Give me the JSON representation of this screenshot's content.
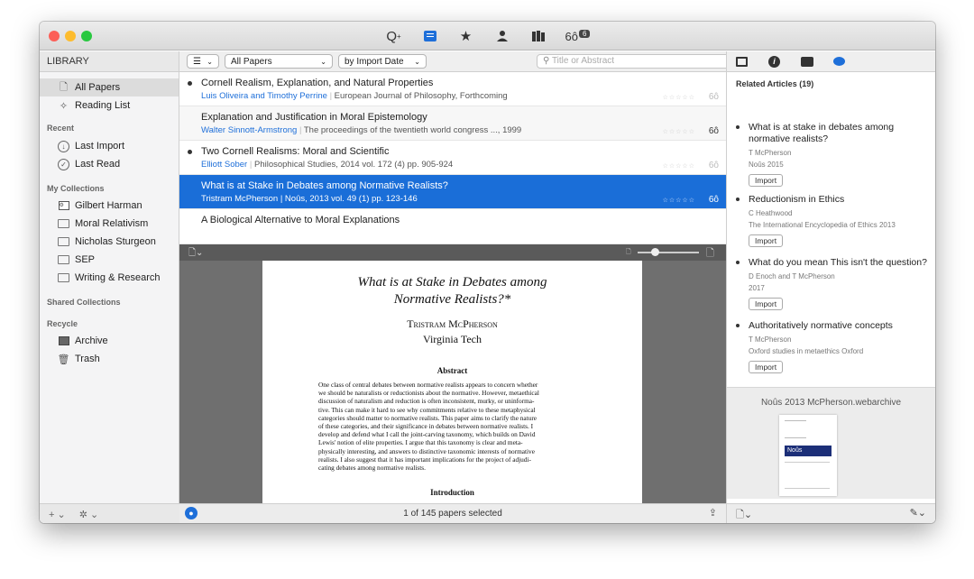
{
  "toolbar": {
    "badge": "6"
  },
  "sidebar": {
    "header": "LIBRARY",
    "items": [
      {
        "label": "All Papers"
      },
      {
        "label": "Reading List"
      }
    ],
    "recent_title": "Recent",
    "recent": [
      {
        "label": "Last Import"
      },
      {
        "label": "Last Read"
      }
    ],
    "collections_title": "My Collections",
    "collections": [
      {
        "label": "Gilbert Harman"
      },
      {
        "label": "Moral Relativism"
      },
      {
        "label": "Nicholas Sturgeon"
      },
      {
        "label": "SEP"
      },
      {
        "label": "Writing & Research"
      }
    ],
    "shared_title": "Shared Collections",
    "recycle_title": "Recycle",
    "recycle": [
      {
        "label": "Archive"
      },
      {
        "label": "Trash"
      }
    ],
    "footer_add": "+ ⌄",
    "footer_gear": "✲ ⌄"
  },
  "list": {
    "filter": "All Papers",
    "sort": "by Import Date",
    "search_placeholder": "Title or Abstract",
    "papers": [
      {
        "title": "Cornell Realism, Explanation, and Natural Properties",
        "authors": "Luis Oliveira and Timothy Perrine",
        "source": "European Journal of Philosophy, Forthcoming"
      },
      {
        "title": "Explanation and Justification in Moral Epistemology",
        "authors": "Walter Sinnott-Armstrong",
        "source": "The proceedings of the twentieth world congress ..., 1999"
      },
      {
        "title": "Two Cornell Realisms: Moral and Scientific",
        "authors": "Elliott Sober",
        "source": "Philosophical Studies, 2014 vol. 172 (4) pp. 905-924"
      },
      {
        "title": "What is at Stake in Debates among Normative Realists?",
        "authors": "Tristram McPherson",
        "source": "Noûs, 2013 vol. 49 (1) pp. 123-146"
      },
      {
        "title": "A Biological Alternative to Moral Explanations",
        "authors": "",
        "source": ""
      }
    ],
    "stars": "☆☆☆☆☆",
    "glasses": "6ô"
  },
  "pdf": {
    "title_line1": "What is at Stake in Debates among",
    "title_line2": "Normative Realists?*",
    "author": "Tristram McPherson",
    "affiliation": "Virginia Tech",
    "abstract_heading": "Abstract",
    "abstract_lines": [
      "One class of central debates between normative realists appears to concern whether",
      "we should be naturalists or reductionists about the normative. However, metaethical",
      "discussion of naturalism and reduction is often inconsistent, murky, or uninforma-",
      "tive. This can make it hard to see why commitments relative to these metaphysical",
      "categories should matter to normative realists. This paper aims to clarify the nature",
      "of these categories, and their significance in debates between normative realists. I",
      "develop and defend what I call the joint-carving taxonomy, which builds on David",
      "Lewis' notion of elite properties. I argue that this taxonomy is clear and meta-",
      "physically interesting, and answers to distinctive taxonomic interests of normative",
      "realists. I also suggest that it has important implications for the project of adjudi-",
      "cating debates among normative realists."
    ],
    "intro_heading": "Introduction"
  },
  "status": {
    "text": "1 of 145 papers selected"
  },
  "related": {
    "heading": "Related Articles (19)",
    "articles": [
      {
        "title": "What is at stake in debates among normative realists?",
        "author": "T McPherson",
        "venue": "Noûs 2015",
        "button": "Import"
      },
      {
        "title": "Reductionism in Ethics",
        "author": "C Heathwood",
        "venue": "The International Encyclopedia of Ethics 2013",
        "button": "Import"
      },
      {
        "title": "What do you mean This isn't the question?",
        "author": "D Enoch and T McPherson",
        "venue": "2017",
        "button": "Import"
      },
      {
        "title": "Authoritatively normative concepts",
        "author": "T McPherson",
        "venue": "Oxford studies in metaethics Oxford",
        "button": "Import"
      }
    ],
    "attachment": "Noûs 2013 McPherson.webarchive",
    "thumb_label": "Noûs"
  }
}
